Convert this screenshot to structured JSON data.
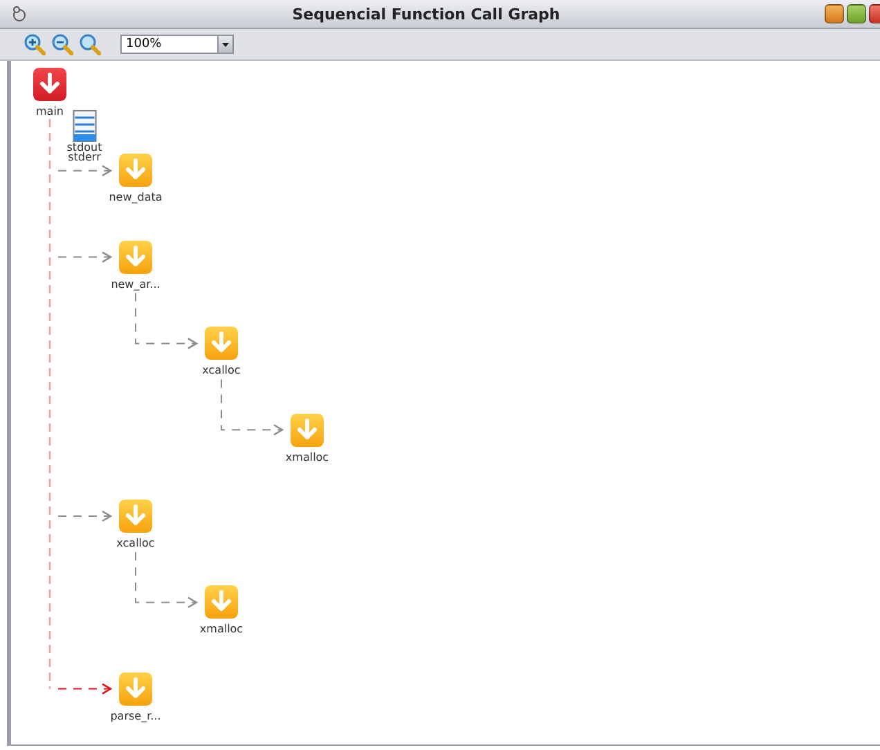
{
  "window": {
    "title": "Sequencial Function Call Graph"
  },
  "toolbar": {
    "zoom": "100%"
  },
  "graph": {
    "root": {
      "label": "main",
      "kind": "main",
      "streams": [
        "stdout",
        "stderr"
      ],
      "children": [
        {
          "label": "new_data",
          "kind": "function",
          "highlighted": false
        },
        {
          "label": "new_ar...",
          "kind": "function",
          "highlighted": false,
          "children": [
            {
              "label": "xcalloc",
              "kind": "function",
              "highlighted": false,
              "children": [
                {
                  "label": "xmalloc",
                  "kind": "function",
                  "highlighted": false
                }
              ]
            }
          ]
        },
        {
          "label": "xcalloc",
          "kind": "function",
          "highlighted": false,
          "children": [
            {
              "label": "xmalloc",
              "kind": "function",
              "highlighted": false
            }
          ]
        },
        {
          "label": "parse_r...",
          "kind": "function",
          "highlighted": true
        }
      ]
    }
  }
}
